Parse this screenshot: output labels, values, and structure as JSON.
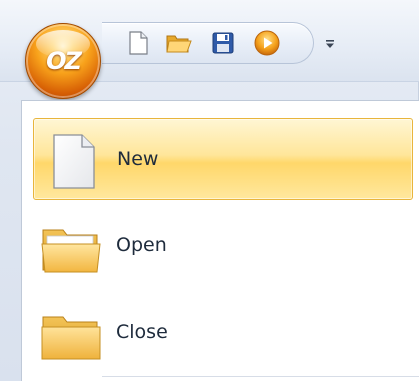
{
  "app": {
    "logo_text": "OZ",
    "orb_icon": "app-orb-icon"
  },
  "quick_access_toolbar": {
    "buttons": [
      {
        "name": "new-document-icon"
      },
      {
        "name": "open-folder-icon"
      },
      {
        "name": "save-disk-icon"
      },
      {
        "name": "run-play-icon"
      }
    ],
    "dropdown_icon": "customize-dropdown-icon"
  },
  "menu": {
    "items": [
      {
        "label": "New",
        "icon": "new-document-icon",
        "selected": true
      },
      {
        "label": "Open",
        "icon": "open-folder-icon",
        "selected": false
      },
      {
        "label": "Close",
        "icon": "close-folder-icon",
        "selected": false
      }
    ]
  },
  "colors": {
    "highlight_top": "#fff6d4",
    "highlight_mid": "#ffd76a",
    "highlight_border": "#e8b53c",
    "orb_orange": "#f8a21b",
    "folder_yellow": "#f7c75a",
    "text": "#1e2b3c"
  }
}
